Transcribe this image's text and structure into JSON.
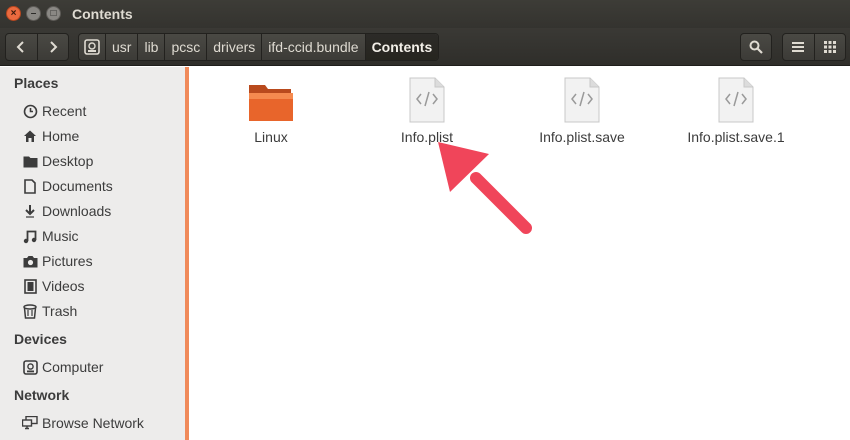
{
  "window": {
    "title": "Contents",
    "close_glyph": "×",
    "minimize_glyph": "–",
    "maximize_glyph": "□"
  },
  "breadcrumbs": [
    "usr",
    "lib",
    "pcsc",
    "drivers",
    "ifd-ccid.bundle",
    "Contents"
  ],
  "sidebar": {
    "places_header": "Places",
    "places": [
      {
        "label": "Recent",
        "icon": "clock-icon"
      },
      {
        "label": "Home",
        "icon": "home-icon"
      },
      {
        "label": "Desktop",
        "icon": "folder-icon"
      },
      {
        "label": "Documents",
        "icon": "document-icon"
      },
      {
        "label": "Downloads",
        "icon": "download-icon"
      },
      {
        "label": "Music",
        "icon": "music-icon"
      },
      {
        "label": "Pictures",
        "icon": "camera-icon"
      },
      {
        "label": "Videos",
        "icon": "film-icon"
      },
      {
        "label": "Trash",
        "icon": "trash-icon"
      }
    ],
    "devices_header": "Devices",
    "devices": [
      {
        "label": "Computer",
        "icon": "drive-icon"
      }
    ],
    "network_header": "Network",
    "network": [
      {
        "label": "Browse Network",
        "icon": "network-icon"
      }
    ]
  },
  "files": [
    {
      "name": "Linux",
      "type": "folder"
    },
    {
      "name": "Info.plist",
      "type": "xml"
    },
    {
      "name": "Info.plist.save",
      "type": "xml"
    },
    {
      "name": "Info.plist.save.1",
      "type": "xml"
    }
  ],
  "colors": {
    "accent": "#f08a5a",
    "arrow": "#f0455a",
    "folder": "#e8652b"
  }
}
